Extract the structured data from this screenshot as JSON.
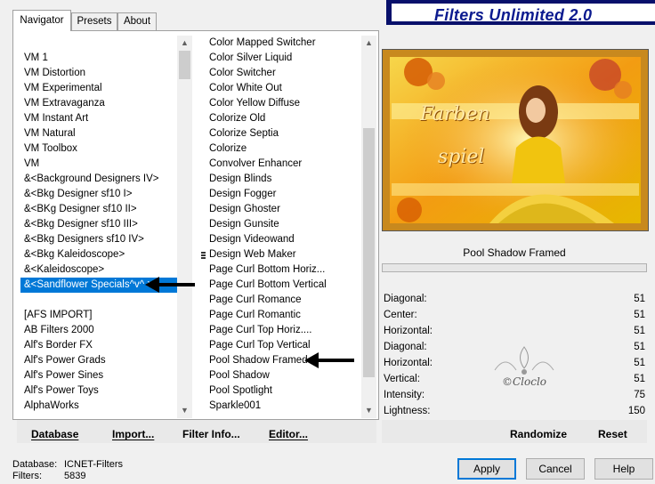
{
  "title": "Filters Unlimited 2.0",
  "tabs": [
    "Navigator",
    "Presets",
    "About"
  ],
  "categories": [
    "VM 1",
    "VM Distortion",
    "VM Experimental",
    "VM Extravaganza",
    "VM Instant Art",
    "VM Natural",
    "VM Toolbox",
    "VM",
    "&<Background Designers IV>",
    "&<Bkg Designer sf10 I>",
    "&<BKg Designer sf10 II>",
    "&<Bkg Designer sf10 III>",
    "&<Bkg Designers sf10 IV>",
    "&<Bkg Kaleidoscope>",
    "&<Kaleidoscope>",
    "&<Sandflower Specials^v^ >",
    "",
    "[AFS IMPORT]",
    "AB Filters 2000",
    "Alf's Border FX",
    "Alf's Power Grads",
    "Alf's Power Sines",
    "Alf's Power Toys",
    "AlphaWorks"
  ],
  "selected_category": "&<Sandflower Specials^v^ >",
  "filters": [
    "Color Mapped Switcher",
    "Color Silver Liquid",
    "Color Switcher",
    "Color White Out",
    "Color Yellow Diffuse",
    "Colorize Old",
    "Colorize Septia",
    "Colorize",
    "Convolver Enhancer",
    "Design Blinds",
    "Design Fogger",
    "Design Ghoster",
    "Design Gunsite",
    "Design Videowand",
    "Design Web Maker",
    "Page Curl Bottom Horiz...",
    "Page Curl Bottom Vertical",
    "Page Curl Romance",
    "Page Curl Romantic",
    "Page Curl Top Horiz....",
    "Page Curl Top Vertical",
    "Pool Shadow Framed",
    "Pool Shadow",
    "Pool Spotlight",
    "Sparkle001"
  ],
  "selected_filter": "Pool Shadow Framed",
  "preview_text": {
    "line1": "Farben",
    "line2": "spiel"
  },
  "filter_name": "Pool Shadow Framed",
  "params": [
    {
      "label": "Diagonal:",
      "value": "51"
    },
    {
      "label": "Center:",
      "value": "51"
    },
    {
      "label": "Horizontal:",
      "value": "51"
    },
    {
      "label": "Diagonal:",
      "value": "51"
    },
    {
      "label": "Horizontal:",
      "value": "51"
    },
    {
      "label": "Vertical:",
      "value": "51"
    },
    {
      "label": "Intensity:",
      "value": "75"
    },
    {
      "label": "Lightness:",
      "value": "150"
    }
  ],
  "watermark": "©Cloclo",
  "bottom_links": {
    "database": "Database",
    "import": "Import...",
    "filter_info": "Filter Info...",
    "editor": "Editor..."
  },
  "right_buttons": {
    "randomize": "Randomize",
    "reset": "Reset"
  },
  "status": {
    "database_label": "Database:",
    "database_value": "ICNET-Filters",
    "filters_label": "Filters:",
    "filters_value": "5839"
  },
  "dialog_buttons": {
    "apply": "Apply",
    "cancel": "Cancel",
    "help": "Help"
  },
  "colors": {
    "title_bg": "#08106b",
    "title_text": "#0b1a8f",
    "selection": "#0078d7"
  }
}
